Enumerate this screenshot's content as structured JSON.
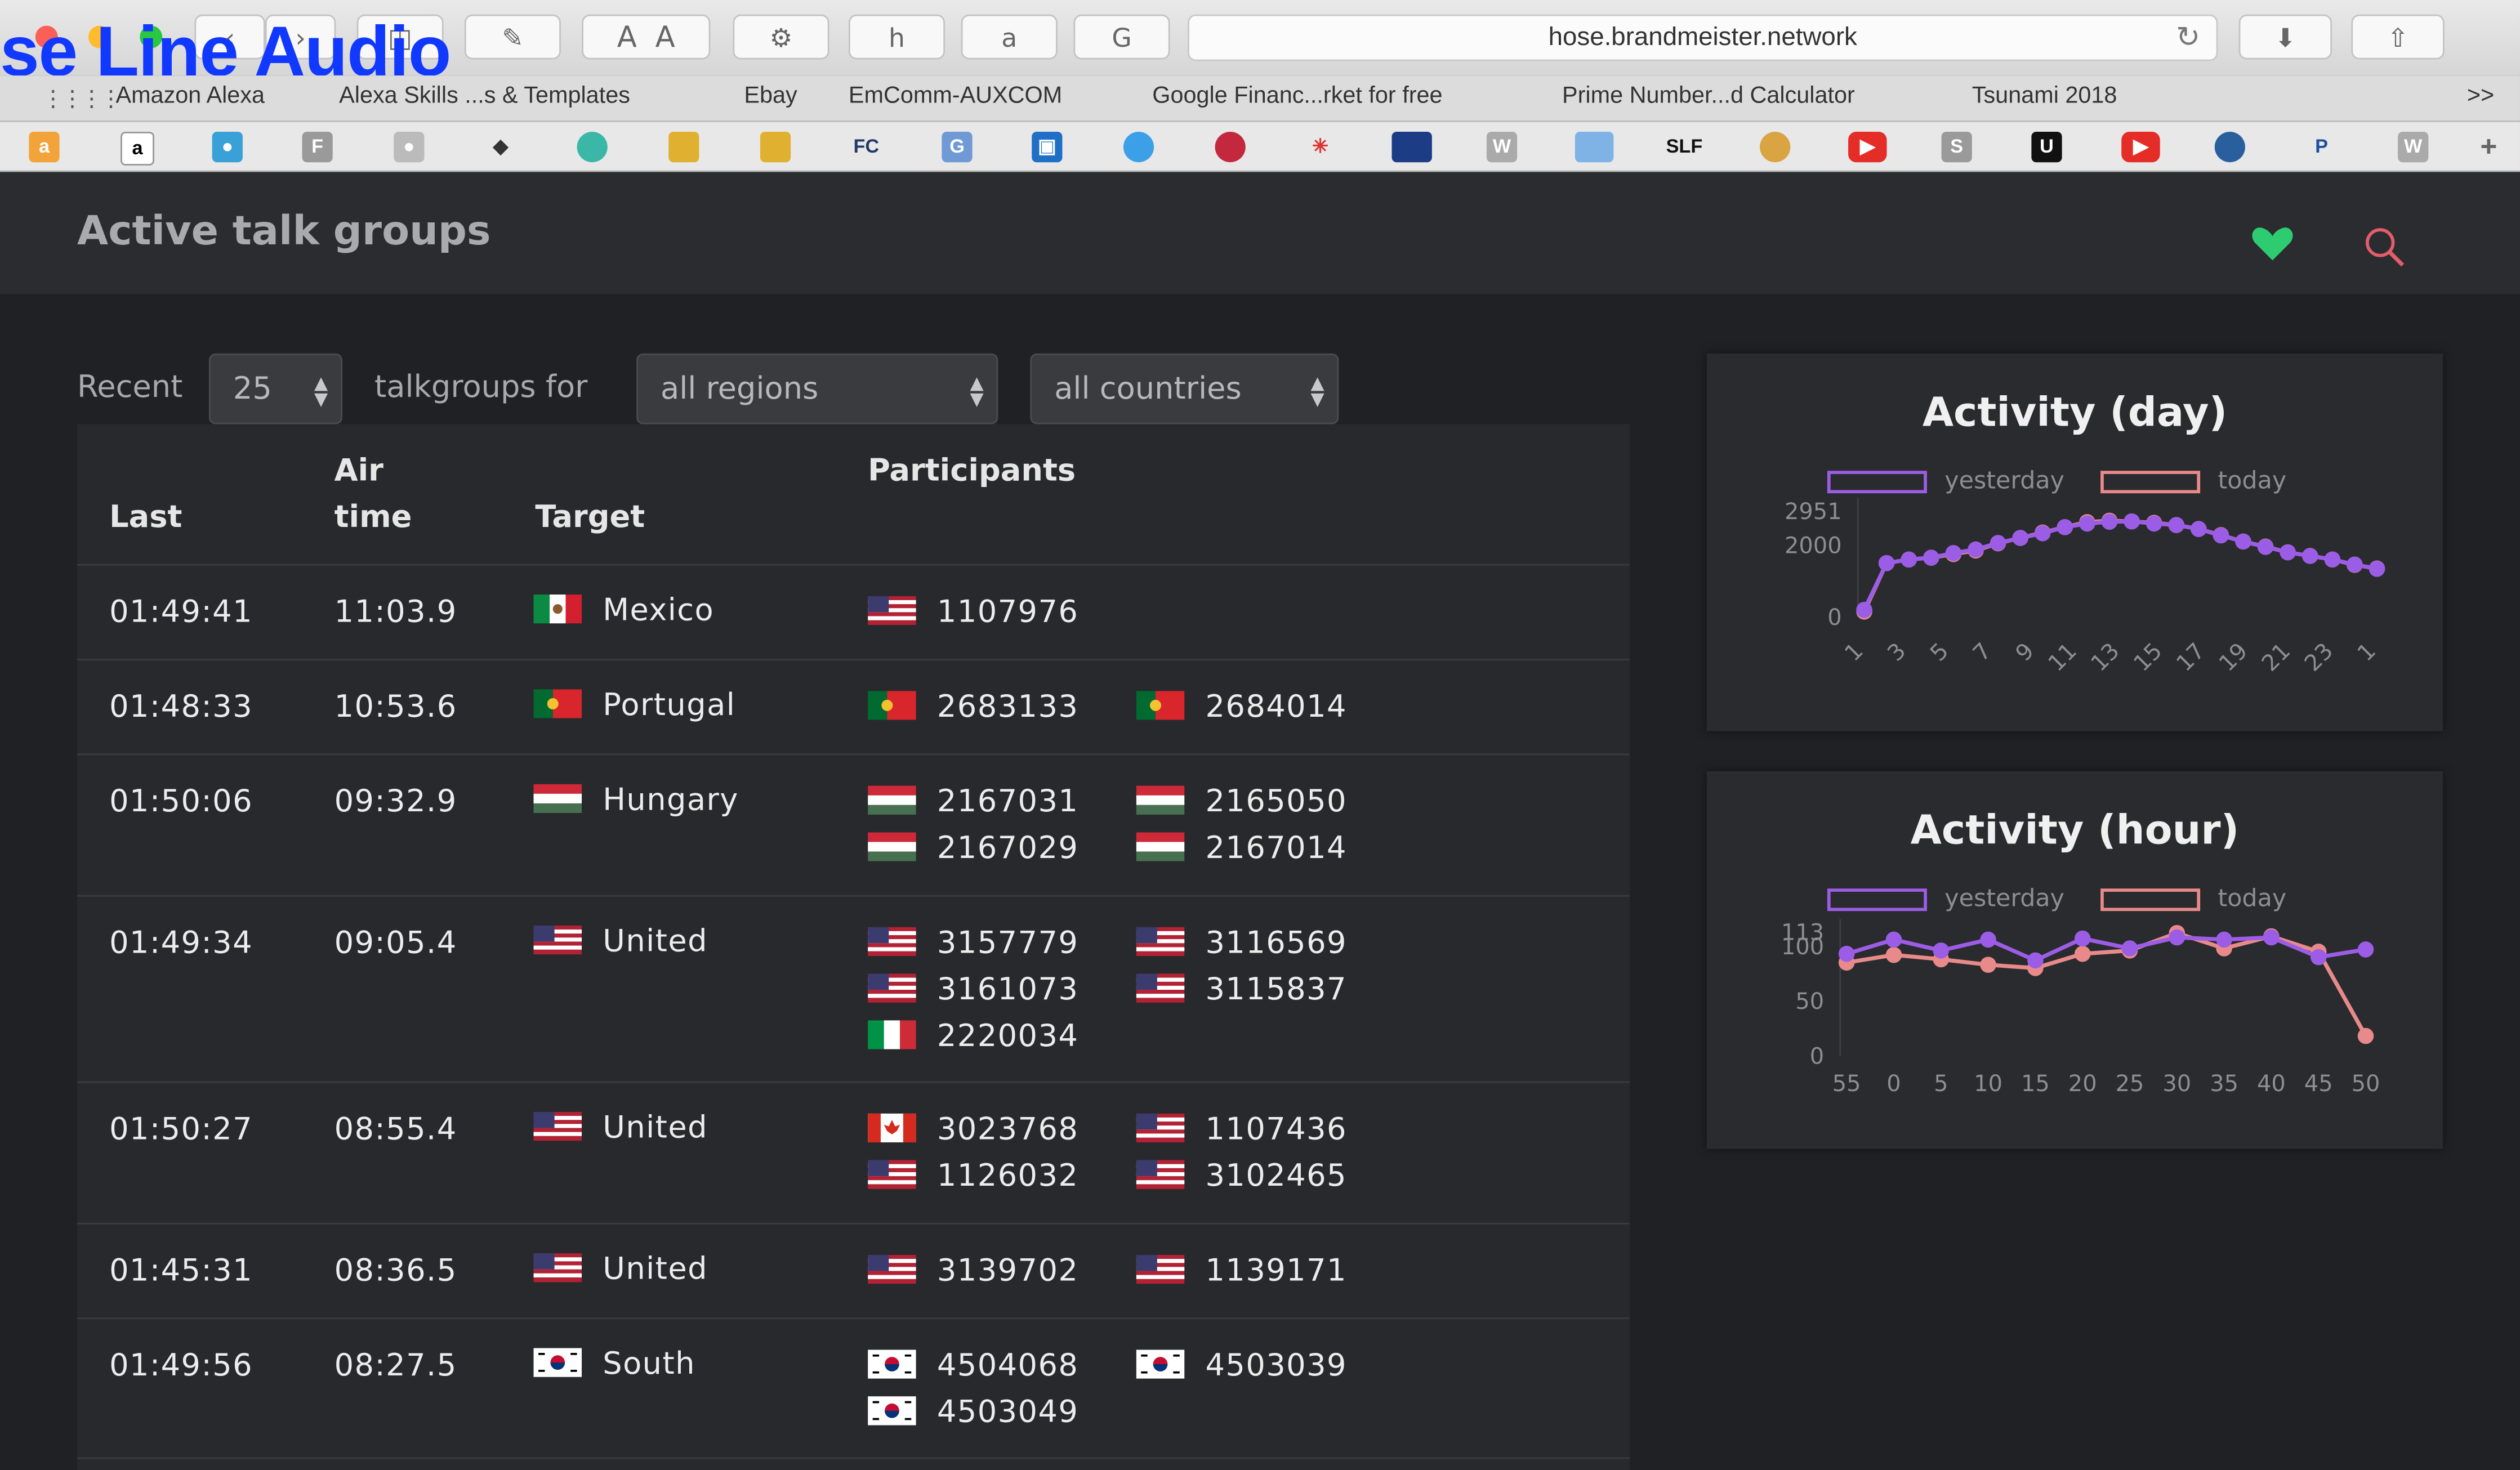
{
  "overlay_title": "se Line Audio",
  "browser": {
    "url": "hose.brandmeister.network",
    "bookmarks": [
      "Amazon Alexa",
      "Alexa Skills ...s & Templates",
      "Ebay",
      "EmComm-AUXCOM",
      "Google Financ...rket for free",
      "Prime Number...d Calculator",
      "Tsunami 2018"
    ],
    "overflow": ">>"
  },
  "app": {
    "title": "Active talk groups"
  },
  "filters": {
    "recent_label": "Recent",
    "recent_value": "25",
    "talkgroups_label": "talkgroups for",
    "region_value": "all regions",
    "country_value": "all countries"
  },
  "table": {
    "headers": {
      "last": "Last",
      "air_time_1": "Air",
      "air_time_2": "time",
      "target": "Target",
      "participants": "Participants"
    },
    "rows": [
      {
        "last": "01:49:41",
        "air": "11:03.9",
        "target": "Mexico",
        "participants": [
          "1107976"
        ]
      },
      {
        "last": "01:48:33",
        "air": "10:53.6",
        "target": "Portugal",
        "participants": [
          "2683133",
          "2684014"
        ]
      },
      {
        "last": "01:50:06",
        "air": "09:32.9",
        "target": "Hungary",
        "participants": [
          "2167031",
          "2165050",
          "2167029",
          "2167014"
        ]
      },
      {
        "last": "01:49:34",
        "air": "09:05.4",
        "target": "United",
        "participants": [
          "3157779",
          "3116569",
          "3161073",
          "3115837",
          "2220034"
        ]
      },
      {
        "last": "01:50:27",
        "air": "08:55.4",
        "target": "United",
        "participants": [
          "3023768",
          "1107436",
          "1126032",
          "3102465"
        ]
      },
      {
        "last": "01:45:31",
        "air": "08:36.5",
        "target": "United",
        "participants": [
          "3139702",
          "1139171"
        ]
      },
      {
        "last": "01:49:56",
        "air": "08:27.5",
        "target": "South",
        "participants": [
          "4504068",
          "4503039",
          "4503049"
        ]
      }
    ]
  },
  "colors": {
    "yesterday": "#9b5de5",
    "today": "#e88a8a",
    "heart": "#2ecc71",
    "search": "#e35d6a"
  },
  "chart_data": [
    {
      "type": "line",
      "title": "Activity (day)",
      "legend": [
        "yesterday",
        "today"
      ],
      "y_ticks": [
        "0",
        "2000",
        "2951"
      ],
      "x_ticks": [
        "1",
        "3",
        "5",
        "7",
        "9",
        "11",
        "13",
        "15",
        "17",
        "19",
        "21",
        "23",
        "1"
      ],
      "series": [
        {
          "name": "yesterday",
          "values": [
            200,
            1500,
            1600,
            1650,
            1780,
            1880,
            2060,
            2200,
            2330,
            2500,
            2600,
            2650,
            2660,
            2600,
            2560,
            2450,
            2270,
            2100,
            1950,
            1800,
            1700,
            1600,
            1460,
            1340
          ]
        },
        {
          "name": "today",
          "values": [
            150,
            1500,
            1600,
            1650,
            1750,
            1850,
            2050,
            2200,
            2350,
            2500,
            2640,
            2680,
            2660,
            2620,
            2560,
            2450,
            2280,
            2100,
            1960,
            1800,
            1700,
            1600,
            1450,
            1350
          ]
        }
      ],
      "ylim": [
        0,
        2951
      ]
    },
    {
      "type": "line",
      "title": "Activity (hour)",
      "legend": [
        "yesterday",
        "today"
      ],
      "y_ticks": [
        "0",
        "50",
        "100",
        "113"
      ],
      "x_ticks": [
        "55",
        "0",
        "5",
        "10",
        "15",
        "20",
        "25",
        "30",
        "35",
        "40",
        "45",
        "50"
      ],
      "series": [
        {
          "name": "yesterday",
          "values": [
            93,
            106,
            96,
            106,
            87,
            107,
            98,
            108,
            106,
            108,
            90,
            97
          ]
        },
        {
          "name": "today",
          "values": [
            85,
            92,
            88,
            83,
            80,
            93,
            96,
            112,
            98,
            109,
            95,
            18
          ]
        }
      ],
      "ylim": [
        0,
        113
      ]
    }
  ]
}
